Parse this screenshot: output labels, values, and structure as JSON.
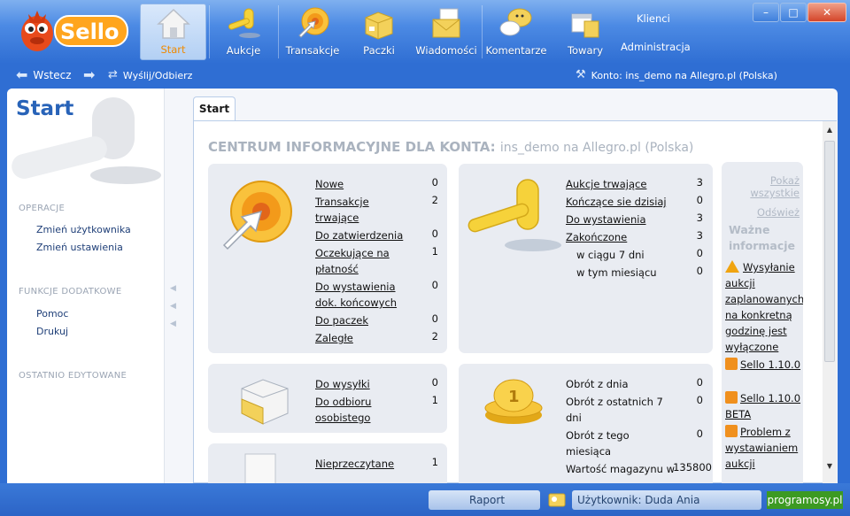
{
  "app": {
    "logo_text": "Sello"
  },
  "nav": {
    "items": [
      {
        "label": "Start",
        "icon": "house-icon",
        "active": true
      },
      {
        "label": "Aukcje",
        "icon": "gavel-icon"
      },
      {
        "label": "Transakcje",
        "icon": "transactions-target-icon"
      },
      {
        "label": "Paczki",
        "icon": "package-icon"
      },
      {
        "label": "Wiadomości",
        "icon": "envelope-icon"
      },
      {
        "label": "Komentarze",
        "icon": "comment-bubbles-icon"
      },
      {
        "label": "Towary",
        "icon": "goods-box-icon"
      }
    ],
    "right_links": {
      "clients": "Klienci",
      "admin": "Administracja"
    }
  },
  "window_controls": {
    "minimize": "–",
    "maximize": "□",
    "close": "✕"
  },
  "subbar": {
    "back": "Wstecz",
    "forward_icon": "arrow-right-icon",
    "send_receive": "Wyślij/Odbierz",
    "account": "Konto: ins_demo na Allegro.pl (Polska)"
  },
  "sidebar": {
    "title": "Start",
    "sections": [
      {
        "title": "OPERACJE",
        "links": [
          "Zmień użytkownika",
          "Zmień ustawienia"
        ]
      },
      {
        "title": "FUNKCJE DODATKOWE",
        "links": [
          "Pomoc",
          "Drukuj"
        ]
      },
      {
        "title": "OSTATNIO EDYTOWANE",
        "links": []
      }
    ]
  },
  "tab": {
    "label": "Start"
  },
  "content": {
    "heading": "CENTRUM INFORMACYJNE  DLA KONTA:",
    "heading_account": "ins_demo na Allegro.pl (Polska)",
    "transactions_panel": [
      {
        "label": "Nowe",
        "value": "0"
      },
      {
        "label": "Transakcje trwające",
        "value": "2"
      },
      {
        "label": "Do zatwierdzenia",
        "value": "0"
      },
      {
        "label": "Oczekujące na płatność",
        "value": "1"
      },
      {
        "label": "Do wystawienia dok. końcowych",
        "value": "0"
      },
      {
        "label": "Do paczek",
        "value": "0"
      },
      {
        "label": "Zaległe",
        "value": "2"
      }
    ],
    "auctions_panel": [
      {
        "label": "Aukcje trwające",
        "value": "3",
        "link": true
      },
      {
        "label": "Kończące sie dzisiaj",
        "value": "0",
        "link": true
      },
      {
        "label": "Do wystawienia",
        "value": "3",
        "link": true
      },
      {
        "label": "Zakończone",
        "value": "3",
        "link": true
      },
      {
        "label": "w ciągu 7 dni",
        "value": "0",
        "link": false
      },
      {
        "label": "w tym miesiącu",
        "value": "0",
        "link": false
      }
    ],
    "packages_panel": [
      {
        "label": "Do wysyłki",
        "value": "0"
      },
      {
        "label": "Do odbioru osobistego",
        "value": "1"
      }
    ],
    "turnover_panel": [
      {
        "label": "Obrót z dnia",
        "value": "0"
      },
      {
        "label": "Obrót z ostatnich 7 dni",
        "value": "0"
      },
      {
        "label": "Obrót z tego miesiąca",
        "value": "0"
      },
      {
        "label": "Wartość magazynu w",
        "value": "135800"
      }
    ],
    "messages_panel": [
      {
        "label": "Nieprzeczytane",
        "value": "1"
      }
    ],
    "news": {
      "show_all": "Pokaż wszystkie",
      "refresh": "Odśwież",
      "header": "Ważne informacje",
      "items": [
        {
          "icon": "warning-icon",
          "text": "Wysyłanie aukcji zaplanowanych na konkretną godzinę jest wyłączone"
        },
        {
          "icon": "rss-icon",
          "text": "Sello 1.10.0"
        },
        {
          "icon": "rss-icon",
          "text": "Sello 1.10.0 BETA"
        },
        {
          "icon": "rss-icon",
          "text": "Problem z wystawianiem aukcji"
        }
      ]
    }
  },
  "status": {
    "report": "Raport",
    "user": "Użytkownik: Duda Ania",
    "badge": "programosy.pl"
  },
  "colors": {
    "accent_orange": "#f08a00",
    "brand_blue": "#2f6ed3",
    "badge_green": "#3c9a22"
  }
}
